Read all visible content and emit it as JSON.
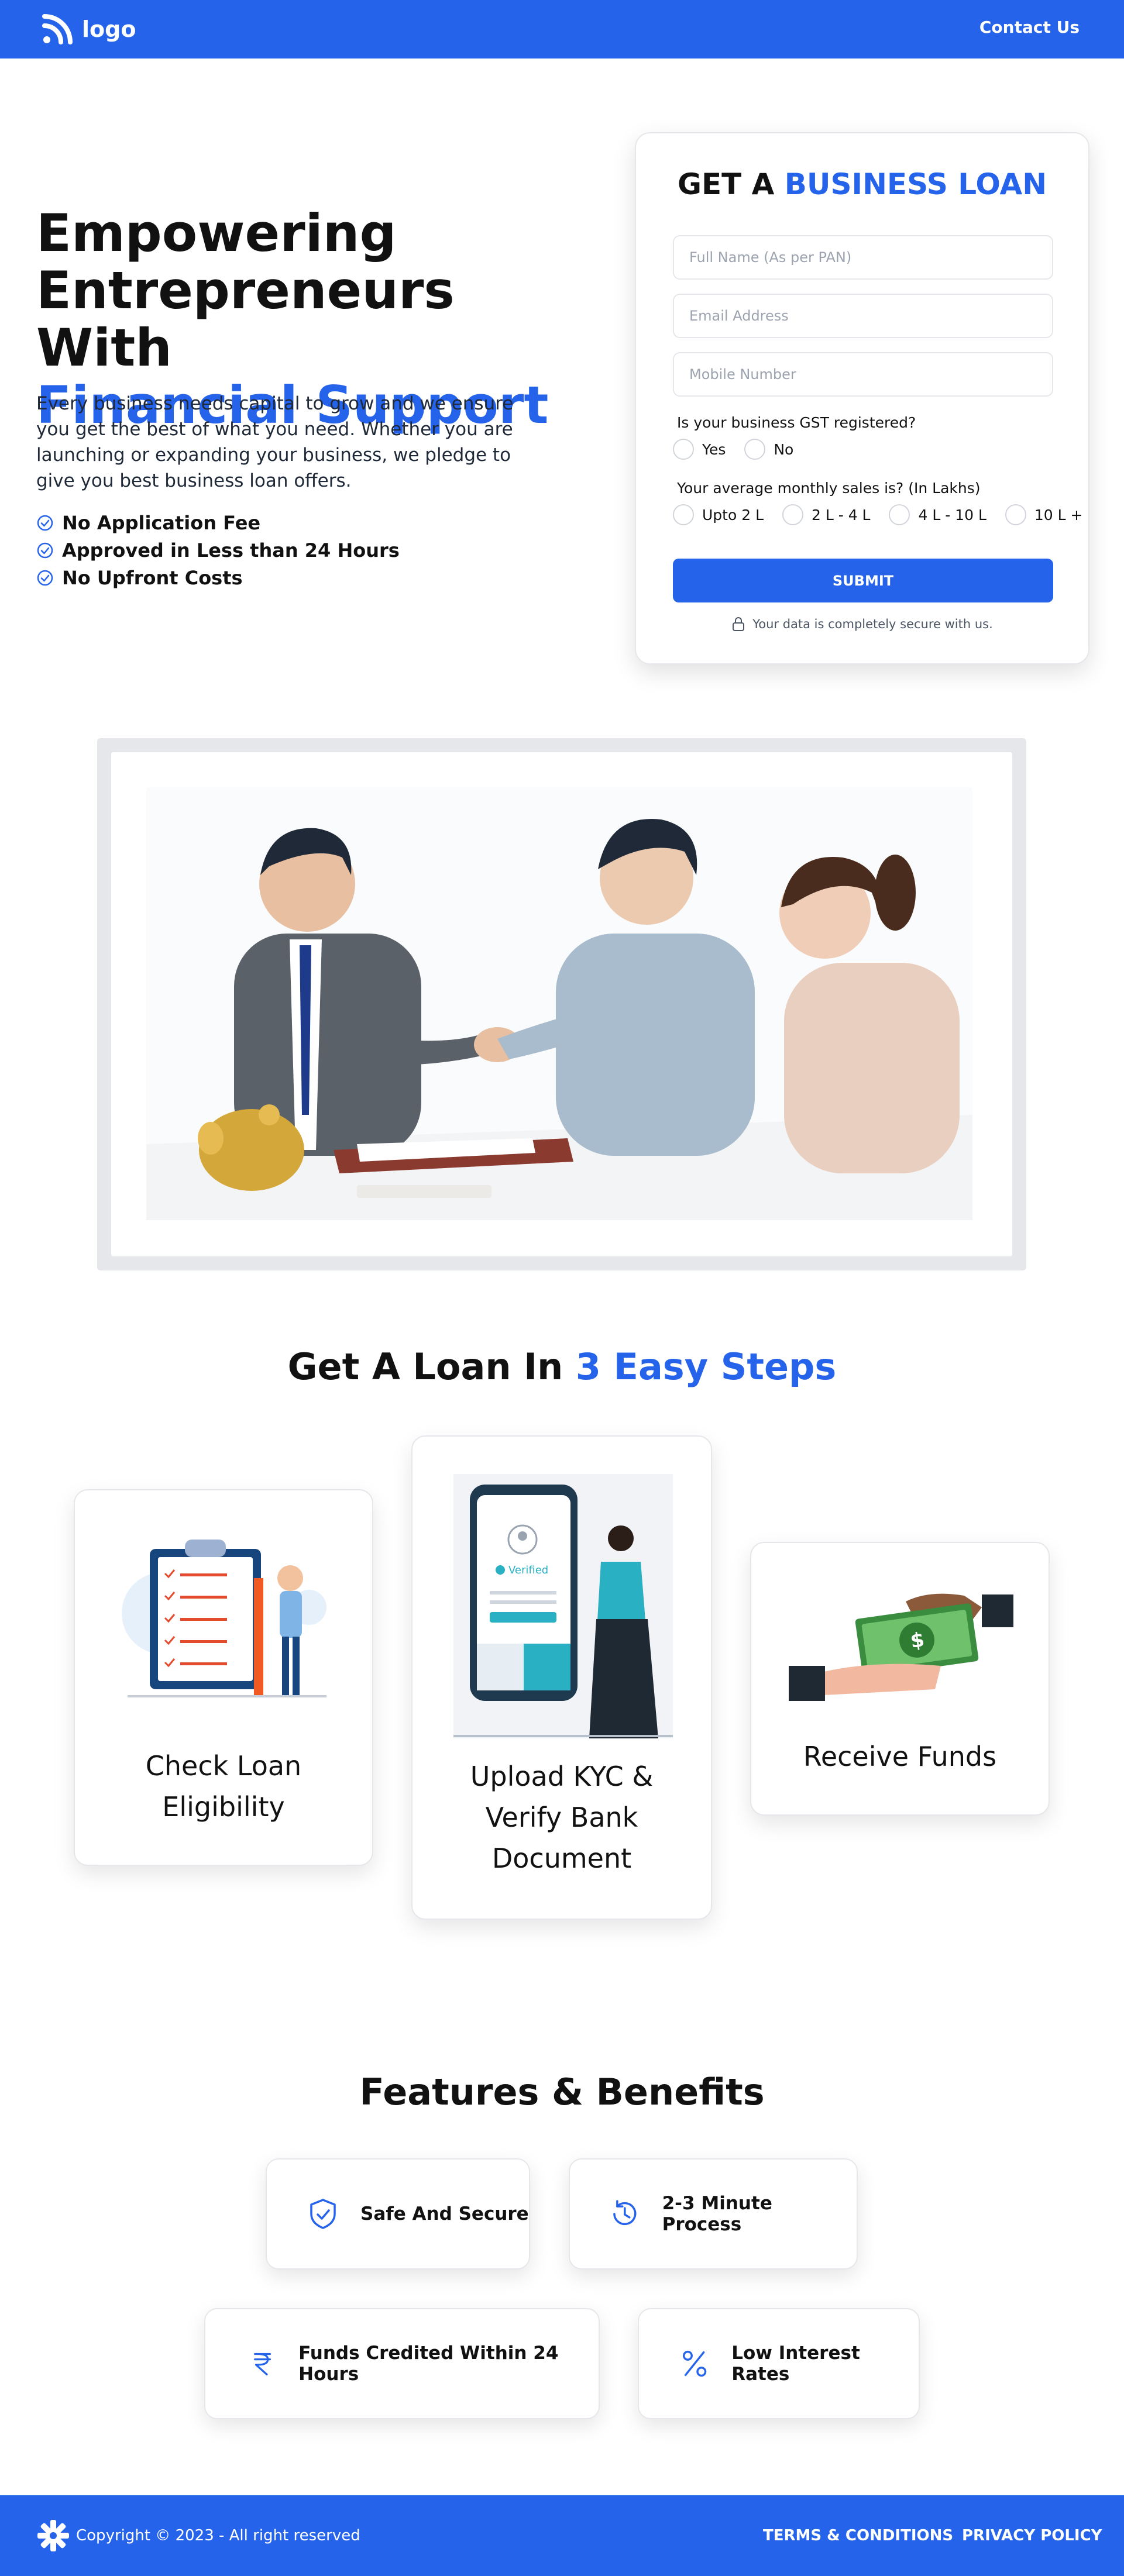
{
  "header": {
    "logo_text": "logo",
    "contact_label": "Contact Us",
    "color": "#2563eb"
  },
  "hero": {
    "title_line1": "Empowering",
    "title_line2": "Entrepreneurs With",
    "title_highlight": "Financial Support",
    "description": "Every business needs capital to grow and we ensure you get the best of what you need. Whether you are launching or expanding your business, we pledge to give you best business loan offers.",
    "bullets": [
      "No Application Fee",
      "Approved in Less than 24 Hours",
      "No Upfront Costs"
    ]
  },
  "form": {
    "title_prefix": "GET A",
    "title_highlight": "BUSINESS LOAN",
    "name_placeholder": "Full Name (As per PAN)",
    "email_placeholder": "Email Address",
    "mobile_placeholder": "Mobile Number",
    "gst_question": "Is your business GST registered?",
    "gst_options": [
      "Yes",
      "No"
    ],
    "sales_question": "Your average monthly sales is? (In Lakhs)",
    "sales_options": [
      "Upto 2 L",
      "2 L - 4 L",
      "4 L - 10 L",
      "10 L +"
    ],
    "submit_label": "SUBMIT",
    "secure_note": "Your data is completely secure with us."
  },
  "steps": {
    "title_prefix": "Get A Loan In",
    "title_highlight": "3 Easy Steps",
    "items": [
      {
        "line1": "Check Loan",
        "line2": "Eligibility",
        "icon": "checklist-icon"
      },
      {
        "line1": "Upload KYC &",
        "line2": "Verify Bank",
        "line3": "Document",
        "icon": "kyc-phone-icon",
        "badge": "Verified"
      },
      {
        "line1": "Receive Funds",
        "icon": "money-handoff-icon"
      }
    ]
  },
  "features": {
    "title": "Features & Benefits",
    "items": [
      {
        "label": "Safe And Secure",
        "icon": "shield-check-icon"
      },
      {
        "label": "2-3 Minute Process",
        "icon": "clock-history-icon"
      },
      {
        "label": "Funds Credited Within 24 Hours",
        "icon": "rupee-icon"
      },
      {
        "label": "Low Interest Rates",
        "icon": "percent-icon"
      }
    ]
  },
  "footer": {
    "copyright": "Copyright © 2023 - All right reserved",
    "terms_label": "TERMS & CONDITIONS",
    "privacy_label": "PRIVACY POLICY"
  }
}
